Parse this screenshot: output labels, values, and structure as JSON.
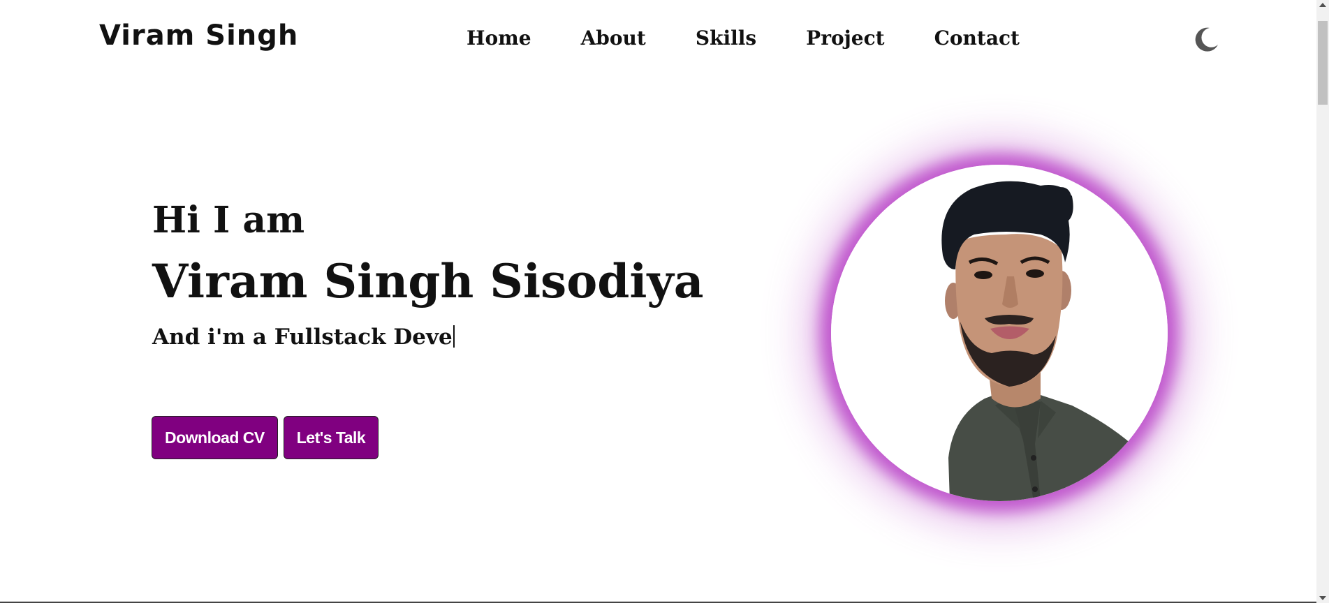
{
  "header": {
    "logo": "Viram Singh",
    "nav": [
      {
        "label": "Home"
      },
      {
        "label": "About"
      },
      {
        "label": "Skills"
      },
      {
        "label": "Project"
      },
      {
        "label": "Contact"
      }
    ],
    "theme_toggle_icon": "moon-icon"
  },
  "hero": {
    "greeting": "Hi I am",
    "name": "Viram Singh Sisodiya",
    "role_text": "And i'm a Fullstack Deve",
    "buttons": {
      "download": "Download CV",
      "talk": "Let's Talk"
    },
    "photo_icon": "profile-photo"
  },
  "colors": {
    "accent": "#800080",
    "glow": "#ba46c8",
    "text": "#111111",
    "background": "#ffffff"
  }
}
